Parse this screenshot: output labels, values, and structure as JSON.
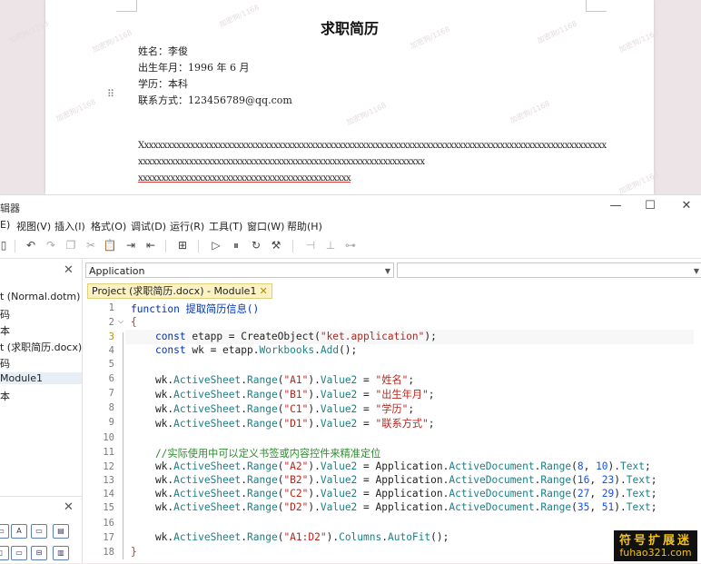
{
  "document": {
    "title": "求职简历",
    "fields": [
      "姓名：李俊",
      "出生年月：1996 年 6 月",
      "学历：本科",
      "联系方式：123456789@qq.com"
    ],
    "x_lines": [
      "Xxxxxxxxxxxxxxxxxxxxxxxxxxxxxxxxxxxxxxxxxxxxxxxxxxxxxxxxxxxxxxxxxxxxxxxxxxxxxxxxxxxxxxxxxxxxxxxxxxxxx",
      "xxxxxxxxxxxxxxxxxxxxxxxxxxxxxxxxxxxxxxxxxxxxxxxxxxxxxxxxxxxxxx",
      "xxxxxxxxxxxxxxxxxxxxxxxxxxxxxxxxxxxxxxxxxxxxxx"
    ],
    "drag_handle": "⠿",
    "watermark": "加密狗/1168"
  },
  "window": {
    "title": "辑器",
    "minimize": "—",
    "maximize": "☐",
    "close": "✕"
  },
  "menu": [
    "E)",
    "视图(V)",
    "插入(I)",
    "格式(O)",
    "调试(D)",
    "运行(R)",
    "工具(T)",
    "窗口(W)",
    "帮助(H)"
  ],
  "toolbar": {
    "icons": [
      "doc-icon",
      "undo-icon",
      "redo-icon",
      "copy-icon",
      "cut-icon",
      "paste-icon",
      "indent-icon",
      "outdent-icon",
      "module-icon",
      "run-icon",
      "pause-icon",
      "reset-icon",
      "design-icon",
      "tool-a-icon",
      "tool-b-icon",
      "tool-c-icon"
    ],
    "glyphs": [
      "▯",
      "↶",
      "↷",
      "❐",
      "✂",
      "📋",
      "⇥",
      "⇤",
      "⊞",
      "▷",
      "⏸",
      "↻",
      "⚒",
      "⊣",
      "⊥",
      "⊶"
    ]
  },
  "project_panel": {
    "close": "✕",
    "items": [
      "t (Normal.dotm)",
      "码",
      "本",
      "t (求职简历.docx)",
      "码",
      " Module1",
      "本"
    ],
    "selected_index": 5
  },
  "toolbox": {
    "close": "✕",
    "glyphs": [
      "▭",
      "A",
      "▭",
      "▤",
      "▯",
      "▭",
      "⊟",
      "▥"
    ]
  },
  "combos": {
    "object": "Application",
    "procedure": ""
  },
  "tab": {
    "label": "Project (求职简历.docx) - Module1",
    "close": "✕"
  },
  "code_lines": [
    {
      "n": "1",
      "t": "function 提取简历信息()"
    },
    {
      "n": "2",
      "t": "{"
    },
    {
      "n": "3",
      "t": "    const etapp = CreateObject(\"ket.application\");"
    },
    {
      "n": "4",
      "t": "    const wk = etapp.Workbooks.Add();"
    },
    {
      "n": "5",
      "t": ""
    },
    {
      "n": "6",
      "t": "    wk.ActiveSheet.Range(\"A1\").Value2 = \"姓名\";"
    },
    {
      "n": "7",
      "t": "    wk.ActiveSheet.Range(\"B1\").Value2 = \"出生年月\";"
    },
    {
      "n": "8",
      "t": "    wk.ActiveSheet.Range(\"C1\").Value2 = \"学历\";"
    },
    {
      "n": "9",
      "t": "    wk.ActiveSheet.Range(\"D1\").Value2 = \"联系方式\";"
    },
    {
      "n": "10",
      "t": ""
    },
    {
      "n": "11",
      "t": "    //实际使用中可以定义书签或内容控件来精准定位"
    },
    {
      "n": "12",
      "t": "    wk.ActiveSheet.Range(\"A2\").Value2 = Application.ActiveDocument.Range(8, 10).Text;"
    },
    {
      "n": "13",
      "t": "    wk.ActiveSheet.Range(\"B2\").Value2 = Application.ActiveDocument.Range(16, 23).Text;"
    },
    {
      "n": "14",
      "t": "    wk.ActiveSheet.Range(\"C2\").Value2 = Application.ActiveDocument.Range(27, 29).Text;"
    },
    {
      "n": "15",
      "t": "    wk.ActiveSheet.Range(\"D2\").Value2 = Application.ActiveDocument.Range(35, 51).Text;"
    },
    {
      "n": "16",
      "t": ""
    },
    {
      "n": "17",
      "t": "    wk.ActiveSheet.Range(\"A1:D2\").Columns.AutoFit();"
    },
    {
      "n": "18",
      "t": "}"
    }
  ],
  "current_line": 3,
  "fold_marker": "⌵",
  "logo": {
    "cn": "符号扩展迷",
    "en": "fuhao321.com"
  },
  "colors": {
    "keyword": "#0033b3",
    "string": "#b3261e",
    "member": "#1b7f86",
    "comment": "#2e8b2e",
    "number": "#1750eb",
    "tab_bg": "#fdf2c4",
    "logo_text": "#f3c316"
  }
}
